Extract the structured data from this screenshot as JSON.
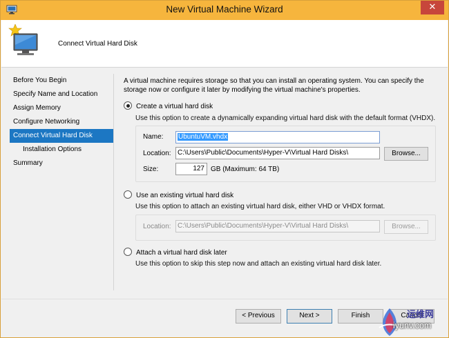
{
  "window": {
    "title": "New Virtual Machine Wizard",
    "close_label": "✕"
  },
  "header": {
    "page_title": "Connect Virtual Hard Disk"
  },
  "nav": {
    "items": [
      {
        "label": "Before You Begin"
      },
      {
        "label": "Specify Name and Location"
      },
      {
        "label": "Assign Memory"
      },
      {
        "label": "Configure Networking"
      },
      {
        "label": "Connect Virtual Hard Disk"
      },
      {
        "label": "Installation Options"
      },
      {
        "label": "Summary"
      }
    ],
    "active_index": 4
  },
  "main": {
    "intro": "A virtual machine requires storage so that you can install an operating system. You can specify the storage now or configure it later by modifying the virtual machine's properties.",
    "create": {
      "label": "Create a virtual hard disk",
      "selected": true,
      "description": "Use this option to create a dynamically expanding virtual hard disk with the default format (VHDX).",
      "name_label": "Name:",
      "name_value": "UbuntuVM.vhdx",
      "location_label": "Location:",
      "location_value": "C:\\Users\\Public\\Documents\\Hyper-V\\Virtual Hard Disks\\",
      "browse_label": "Browse...",
      "size_label": "Size:",
      "size_value": "127",
      "size_unit": "GB (Maximum: 64 TB)"
    },
    "existing": {
      "label": "Use an existing virtual hard disk",
      "selected": false,
      "description": "Use this option to attach an existing virtual hard disk, either VHD or VHDX format.",
      "location_label": "Location:",
      "location_value": "C:\\Users\\Public\\Documents\\Hyper-V\\Virtual Hard Disks\\",
      "browse_label": "Browse..."
    },
    "later": {
      "label": "Attach a virtual hard disk later",
      "selected": false,
      "description": "Use this option to skip this step now and attach an existing virtual hard disk later."
    }
  },
  "footer": {
    "previous_label": "< Previous",
    "next_label": "Next >",
    "finish_label": "Finish",
    "cancel_label": "Cancel"
  },
  "watermark": {
    "text1": "运维网",
    "text2": "iyunv.com"
  },
  "colors": {
    "titlebar": "#f6b53d",
    "selection": "#1c77c3",
    "close": "#c7463b"
  }
}
